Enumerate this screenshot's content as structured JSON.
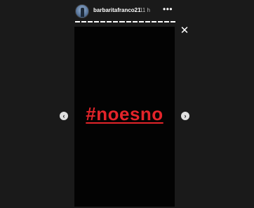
{
  "header": {
    "username": "barbaritafranco21",
    "time": "11 h",
    "more_label": "•••"
  },
  "progress": {
    "segments": 16,
    "completed": 16
  },
  "close_label": "✕",
  "story": {
    "hashtag": "#noesno",
    "text_color": "#e4242a"
  },
  "nav": {
    "prev_label": "‹",
    "next_label": "›"
  }
}
